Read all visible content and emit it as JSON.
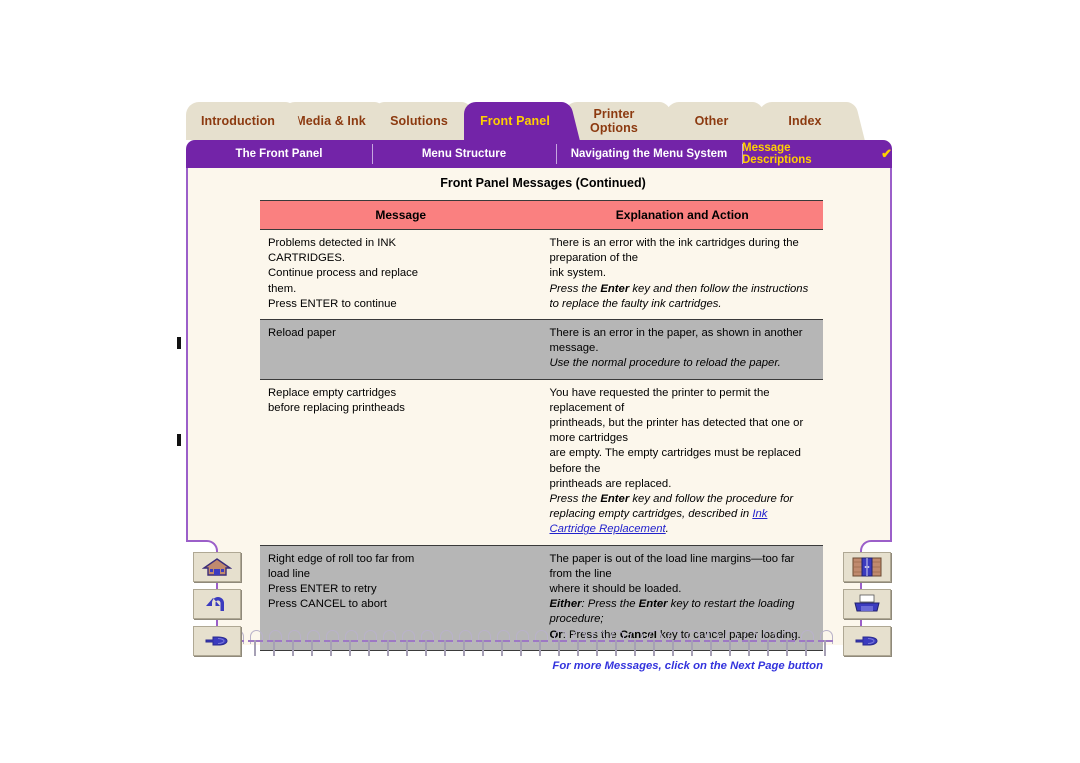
{
  "nav": {
    "tabs": [
      {
        "label": "Introduction",
        "active": false
      },
      {
        "label": "Media & Ink",
        "active": false
      },
      {
        "label": "Solutions",
        "active": false
      },
      {
        "label": "Front Panel",
        "active": true
      },
      {
        "label": "Printer\nOptions",
        "active": false
      },
      {
        "label": "Other",
        "active": false
      },
      {
        "label": "Index",
        "active": false
      }
    ],
    "subitems": [
      {
        "label": "The Front Panel",
        "current": false
      },
      {
        "label": "Menu Structure",
        "current": false
      },
      {
        "label": "Navigating the Menu System",
        "current": false
      },
      {
        "label": "Message Descriptions",
        "current": true
      }
    ],
    "check_glyph": "✔"
  },
  "page": {
    "title": "Front Panel Messages (Continued)",
    "footnote": "For more Messages, click on the Next Page button"
  },
  "table": {
    "headers": [
      "Message",
      "Explanation and Action"
    ],
    "rows": [
      {
        "shaded": false,
        "message_lines": [
          "Problems detected in INK",
          "CARTRIDGES.",
          "Continue process and replace",
          "them.",
          "Press ENTER to continue"
        ],
        "explanation": {
          "plain_lines": [
            "There is an error with the ink cartridges during the preparation of the",
            "ink system."
          ],
          "italic_before": "Press the ",
          "italic_bold": "Enter",
          "italic_after": " key and then follow the instructions to replace the faulty ink cartridges."
        }
      },
      {
        "shaded": true,
        "message_lines": [
          "Reload paper"
        ],
        "explanation": {
          "plain_lines": [
            "There is an error in the paper, as shown in another message."
          ],
          "italic_before": "Use the normal procedure to reload the paper.",
          "italic_bold": "",
          "italic_after": ""
        }
      },
      {
        "shaded": false,
        "message_lines": [
          "Replace empty cartridges",
          "before replacing printheads"
        ],
        "explanation": {
          "plain_lines": [
            "You have requested the printer to permit the replacement of",
            "printheads, but the printer has detected that one or more cartridges",
            "are empty. The empty cartridges must be replaced before the",
            "printheads are replaced."
          ],
          "italic_before": "Press the ",
          "italic_bold": "Enter",
          "italic_after": " key and follow the procedure for replacing empty cartridges, described in ",
          "link_text": "Ink Cartridge Replacement",
          "italic_tail": "."
        }
      },
      {
        "shaded": true,
        "message_lines": [
          "Right edge of roll too far from",
          "load line",
          "Press ENTER to retry",
          "Press CANCEL to abort"
        ],
        "explanation": {
          "plain_lines": [
            "The paper is out of the load line margins—too far from the line",
            "where it should be loaded."
          ],
          "either_label": "Either",
          "either_text_a": ": Press the ",
          "either_bold": "Enter",
          "either_text_b": " key to restart the loading procedure;",
          "or_label": "Or",
          "or_text_a": ": Press the ",
          "or_bold": "Cancel",
          "or_text_b": " key to cancel paper loading."
        }
      }
    ]
  },
  "buttons": {
    "left": [
      {
        "name": "home-button",
        "icon": "home-icon"
      },
      {
        "name": "back-button",
        "icon": "back-arrow-icon"
      },
      {
        "name": "next-page-button",
        "icon": "pointing-hand-icon"
      }
    ],
    "right": [
      {
        "name": "bookshelf-button",
        "icon": "bookshelf-icon"
      },
      {
        "name": "print-button",
        "icon": "printer-icon"
      },
      {
        "name": "forward-button",
        "icon": "pointing-hand-icon"
      }
    ]
  },
  "colors": {
    "tab_active_bg": "#7324A8",
    "tab_inactive_bg": "#E6E0CE",
    "tab_label": "#8C3A10",
    "tab_active_label": "#FFD000",
    "sheet_bg": "#FCF7EC",
    "sheet_border": "#9B5FC9",
    "table_header_bg": "#FA8080",
    "row_shade_bg": "#B6B6B6",
    "link": "#2222CC",
    "footnote": "#3333DD"
  }
}
